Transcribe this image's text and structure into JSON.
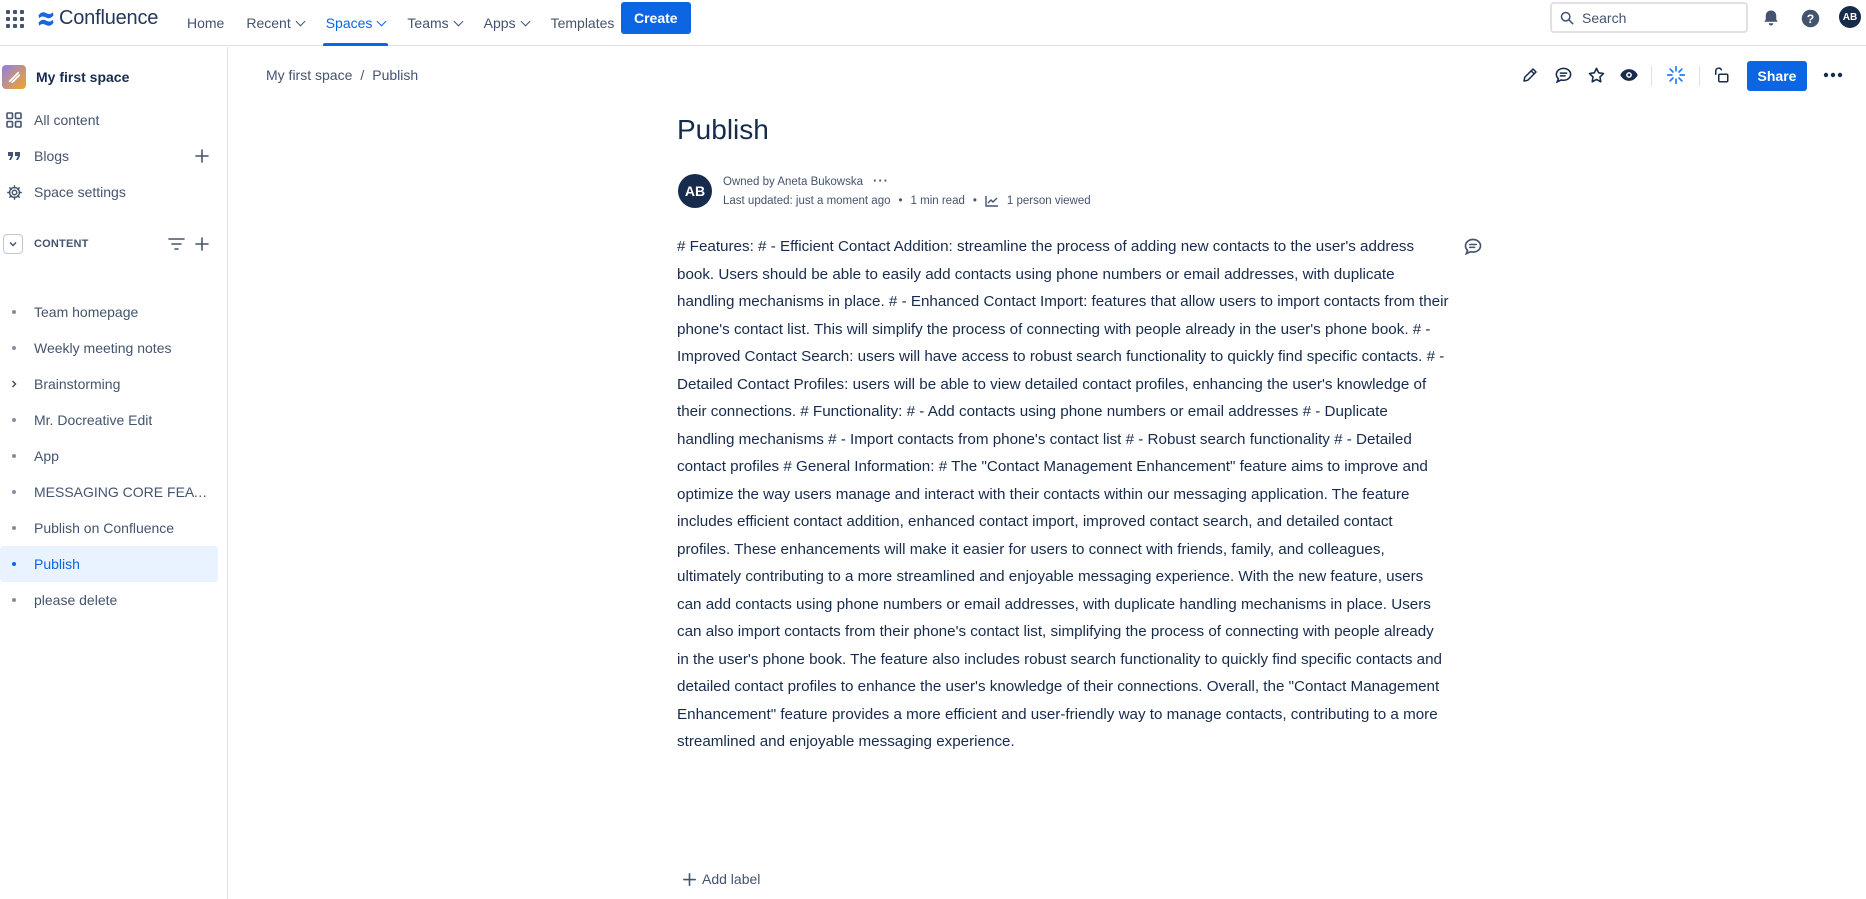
{
  "topbar": {
    "logo_text": "Confluence",
    "nav": [
      {
        "label": "Home",
        "dropdown": false
      },
      {
        "label": "Recent",
        "dropdown": true
      },
      {
        "label": "Spaces",
        "dropdown": true,
        "active": true
      },
      {
        "label": "Teams",
        "dropdown": true
      },
      {
        "label": "Apps",
        "dropdown": true
      },
      {
        "label": "Templates",
        "dropdown": false
      }
    ],
    "create_label": "Create",
    "search_placeholder": "Search",
    "avatar_initials": "AB"
  },
  "sidebar": {
    "space_name": "My first space",
    "links": [
      {
        "label": "All content",
        "icon": "grid-icon"
      },
      {
        "label": "Blogs",
        "icon": "quote-icon"
      },
      {
        "label": "Space settings",
        "icon": "gear-icon"
      }
    ],
    "content_label": "CONTENT",
    "tree": [
      {
        "label": "Team homepage",
        "expandable": false
      },
      {
        "label": "Weekly meeting notes",
        "expandable": false
      },
      {
        "label": "Brainstorming",
        "expandable": true
      },
      {
        "label": "Mr. Docreative Edit",
        "expandable": false
      },
      {
        "label": "App",
        "expandable": false
      },
      {
        "label": "MESSAGING CORE FEATU...",
        "expandable": false
      },
      {
        "label": "Publish on Confluence",
        "expandable": false
      },
      {
        "label": "Publish",
        "expandable": false,
        "active": true
      },
      {
        "label": "please delete",
        "expandable": false
      }
    ]
  },
  "breadcrumb": {
    "space": "My first space",
    "sep": "/",
    "page": "Publish"
  },
  "actions": {
    "share_label": "Share"
  },
  "page": {
    "title": "Publish",
    "owner_prefix": "Owned by",
    "owner": "Aneta Bukowska",
    "author_initials": "AB",
    "last_updated": "Last updated: just a moment ago",
    "read_time": "1 min read",
    "views": "1 person viewed",
    "body": "# Features: # - Efficient Contact Addition: streamline the process of adding new contacts to the user's address book. Users should be able to easily add contacts using phone numbers or email addresses, with duplicate handling mechanisms in place. # - Enhanced Contact Import: features that allow users to import contacts from their phone's contact list. This will simplify the process of connecting with people already in the user's phone book. # - Improved Contact Search: users will have access to robust search functionality to quickly find specific contacts. # - Detailed Contact Profiles: users will be able to view detailed contact profiles, enhancing the user's knowledge of their connections. # Functionality: # - Add contacts using phone numbers or email addresses # - Duplicate handling mechanisms # - Import contacts from phone's contact list # - Robust search functionality # - Detailed contact profiles # General Information: # The \"Contact Management Enhancement\" feature aims to improve and optimize the way users manage and interact with their contacts within our messaging application. The feature includes efficient contact addition, enhanced contact import, improved contact search, and detailed contact profiles. These enhancements will make it easier for users to connect with friends, family, and colleagues, ultimately contributing to a more streamlined and enjoyable messaging experience. With the new feature, users can add contacts using phone numbers or email addresses, with duplicate handling mechanisms in place. Users can also import contacts from their phone's contact list, simplifying the process of connecting with people already in the user's phone book. The feature also includes robust search functionality to quickly find specific contacts and detailed contact profiles to enhance the user's knowledge of their connections. Overall, the \"Contact Management Enhancement\" feature provides a more efficient and user-friendly way to manage contacts, contributing to a more streamlined and enjoyable messaging experience.",
    "add_label": "Add label"
  },
  "colors": {
    "accent": "#0c66e4",
    "text": "#172b4d",
    "subtle": "#44546f",
    "selected_bg": "#e9f2ff"
  }
}
